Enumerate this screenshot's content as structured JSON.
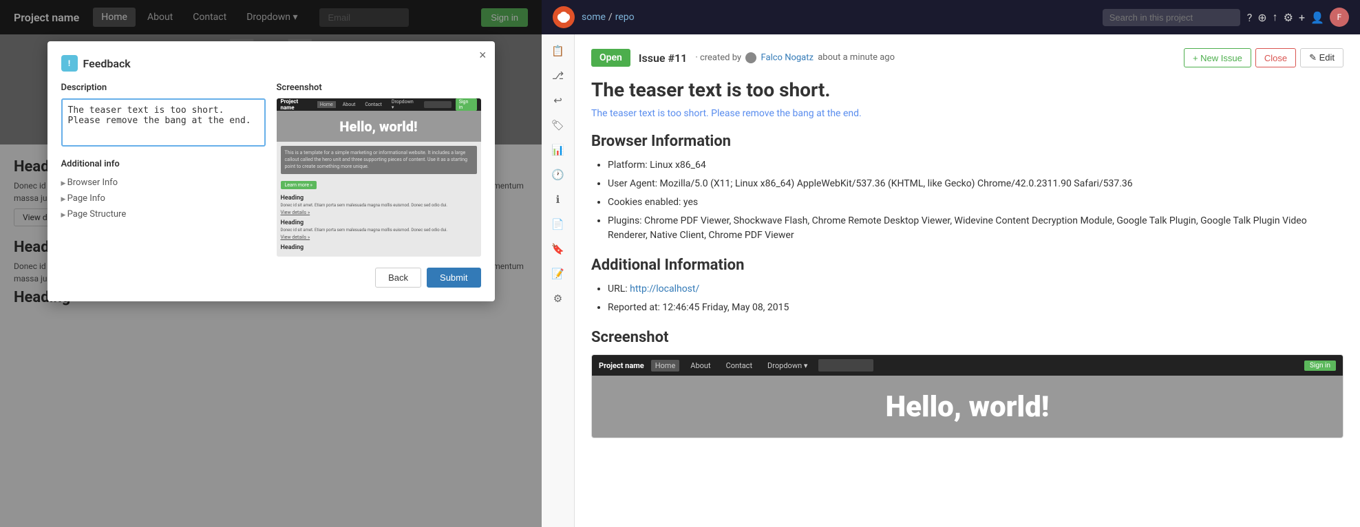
{
  "site": {
    "nav": {
      "brand": "Project name",
      "links": [
        "Home",
        "About",
        "Contact",
        "Dropdown ▾"
      ],
      "active_link": "Home",
      "email_placeholder": "Email",
      "signin_label": "Sign in"
    },
    "hero_text": "H",
    "sections": [
      {
        "heading": "Heading",
        "paragraph": "Donec id elit non mi porta gravida at eget metus. Fusce dapibus, tellus ac cursus commodo, tortor mauris condimentum nibh, ut fermentum massa justo sit amet risus. Etiam porta sem malesuada magna mollis euismod. Donec sed odio dui.",
        "link": "View details »"
      },
      {
        "heading": "Heading",
        "paragraph": "Donec id elit non mi porta gravida at eget metus. Fusce dapibus, tellus ac cursus commodo, tortor mauris condimentum nibh, ut fermentum massa justo sit amet risus. Etiam porta sem malesuada magna mollis euismod. Donec sed odio dui.",
        "link": "View details »"
      },
      {
        "heading": "Heading",
        "paragraph": "",
        "link": ""
      }
    ]
  },
  "modal": {
    "title": "Feedback",
    "description_label": "Description",
    "textarea_content": "The teaser text is too short.\nPlease remove the bang at the end.",
    "screenshot_label": "Screenshot",
    "additional_label": "Additional info",
    "collapse_items": [
      "Browser Info",
      "Page Info",
      "Page Structure"
    ],
    "back_label": "Back",
    "submit_label": "Submit",
    "close_label": "×"
  },
  "gitea": {
    "header": {
      "breadcrumb_user": "some",
      "breadcrumb_repo": "repo",
      "search_placeholder": "Search in this project",
      "icons": [
        "question-circle",
        "search",
        "upload",
        "gear",
        "plus",
        "user",
        "expand"
      ]
    },
    "sidebar_icons": [
      "book",
      "git-branch",
      "history",
      "tag",
      "bar-chart",
      "clock",
      "info",
      "file",
      "tag2",
      "file2",
      "settings"
    ],
    "issue": {
      "badge": "Open",
      "issue_ref": "Issue #11",
      "created_by": "created by",
      "author": "Falco Nogatz",
      "time": "about a minute ago",
      "new_issue_label": "+ New Issue",
      "close_label": "Close",
      "edit_label": "✎ Edit",
      "title": "The teaser text is too short.",
      "description": "The teaser text is too short. Please remove the bang at the end.",
      "browser_info_title": "Browser Information",
      "browser_info_items": [
        "Platform: Linux x86_64",
        "User Agent: Mozilla/5.0 (X11; Linux x86_64) AppleWebKit/537.36 (KHTML, like Gecko) Chrome/42.0.2311.90 Safari/537.36",
        "Cookies enabled: yes",
        "Plugins: Chrome PDF Viewer, Shockwave Flash, Chrome Remote Desktop Viewer, Widevine Content Decryption Module, Google Talk Plugin, Google Talk Plugin Video Renderer, Native Client, Chrome PDF Viewer"
      ],
      "additional_info_title": "Additional Information",
      "additional_info_items": [
        "URL: http://localhost/",
        "Reported at: 12:46:45 Friday, May 08, 2015"
      ],
      "screenshot_title": "Screenshot",
      "screenshot_nav_brand": "Project name",
      "screenshot_nav_links": [
        "Home",
        "About",
        "Contact",
        "Dropdown ▾"
      ],
      "screenshot_hero_text": "Hello, world!"
    }
  }
}
